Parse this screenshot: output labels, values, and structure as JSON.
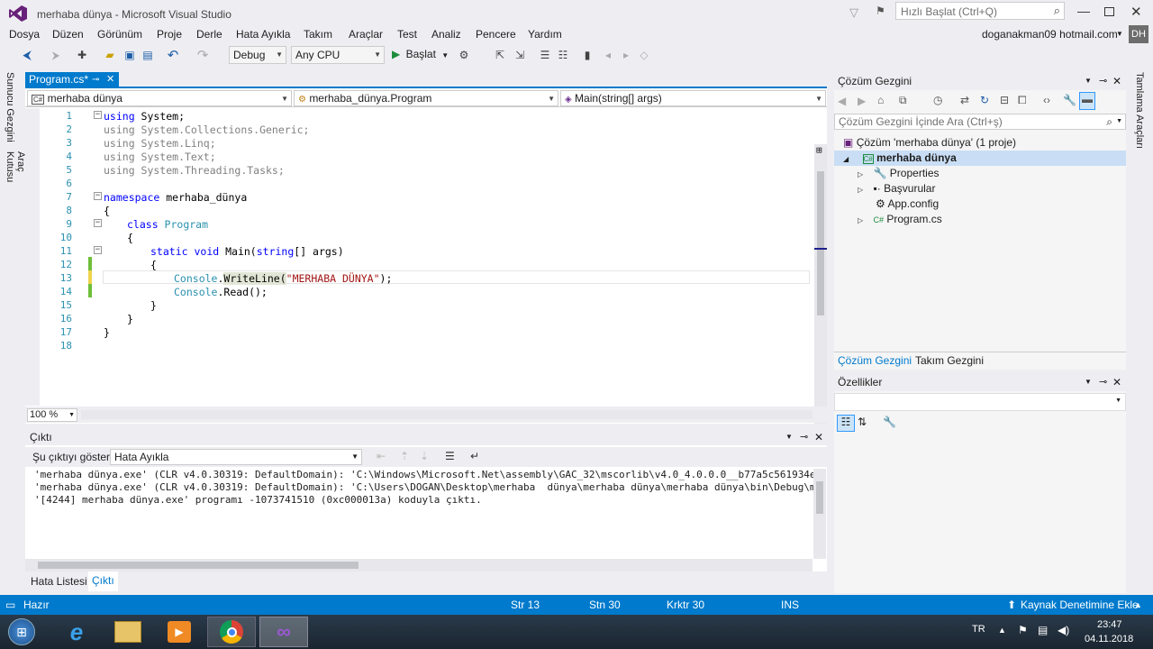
{
  "window": {
    "title": "merhaba dünya - Microsoft Visual Studio",
    "quick_launch_placeholder": "Hızlı Başlat (Ctrl+Q)",
    "user": "doganakman09 hotmail.com",
    "user_initials": "DH"
  },
  "menu": [
    "Dosya",
    "Düzen",
    "Görünüm",
    "Proje",
    "Derle",
    "Hata Ayıkla",
    "Takım",
    "Araçlar",
    "Test",
    "Analiz",
    "Pencere",
    "Yardım"
  ],
  "toolbar": {
    "config": "Debug",
    "platform": "Any CPU",
    "start_label": "Başlat"
  },
  "left_strip": [
    "Sunucu Gezgini",
    "Araç Kutusu"
  ],
  "right_strip": "Tamlama Araçları",
  "editor": {
    "tab_label": "Program.cs*",
    "nav_project": "merhaba dünya",
    "nav_class": "merhaba_dünya.Program",
    "nav_member": "Main(string[] args)",
    "zoom": "100 %",
    "line_numbers": [
      "1",
      "2",
      "3",
      "4",
      "5",
      "6",
      "7",
      "8",
      "9",
      "10",
      "11",
      "12",
      "13",
      "14",
      "15",
      "16",
      "17",
      "18"
    ],
    "lines": {
      "l1_kw": "using",
      "l1_rest": " System;",
      "l2": "using System.Collections.Generic;",
      "l3": "using System.Linq;",
      "l4": "using System.Text;",
      "l5": "using System.Threading.Tasks;",
      "l7_kw": "namespace",
      "l7_rest": " merhaba_dünya",
      "l8": "{",
      "l9_kw": "class",
      "l9_name": " Program",
      "l10": "{",
      "l11_kw1": "static",
      "l11_kw2": " void",
      "l11_rest": " Main(",
      "l11_kw3": "string",
      "l11_rest2": "[] args)",
      "l12": "{",
      "l13_cls": "Console",
      "l13_dot": ".",
      "l13_m": "WriteLine",
      "l13_p": "(",
      "l13_str": "\"MERHABA DÜNYA\"",
      "l13_end": ");",
      "l14_cls": "Console",
      "l14_rest": ".Read();",
      "l15": "}",
      "l16": "}",
      "l17": "}"
    }
  },
  "output": {
    "title": "Çıktı",
    "show_label": "Şu çıktıyı göster:",
    "source": "Hata Ayıkla",
    "lines": [
      "'merhaba dünya.exe' (CLR v4.0.30319: DefaultDomain): 'C:\\Windows\\Microsoft.Net\\assembly\\GAC_32\\mscorlib\\v4.0_4.0.0.0__b77a5c561934e",
      "'merhaba dünya.exe' (CLR v4.0.30319: DefaultDomain): 'C:\\Users\\DOGAN\\Desktop\\merhaba  dünya\\merhaba dünya\\merhaba dünya\\bin\\Debug\\m",
      "'[4244] merhaba dünya.exe' programı -1073741510 (0xc000013a) koduyla çıktı."
    ],
    "tabs": [
      "Hata Listesi",
      "Çıktı"
    ]
  },
  "solution": {
    "title": "Çözüm Gezgini",
    "search_placeholder": "Çözüm Gezgini İçinde Ara (Ctrl+ş)",
    "items": [
      "Çözüm 'merhaba dünya' (1 proje)",
      "merhaba dünya",
      "Properties",
      "Başvurular",
      "App.config",
      "Program.cs"
    ],
    "tabs": [
      "Çözüm Gezgini",
      "Takım Gezgini"
    ]
  },
  "properties": {
    "title": "Özellikler"
  },
  "status": {
    "ready": "Hazır",
    "line": "Str 13",
    "col": "Stn 30",
    "char": "Krktr 30",
    "mode": "INS",
    "source_control": "Kaynak Denetimine Ekle"
  },
  "taskbar": {
    "lang": "TR",
    "time": "23:47",
    "date": "04.11.2018"
  },
  "colors": {
    "accent": "#007acc",
    "vs_purple": "#68217a",
    "keyword": "#0000ff",
    "type": "#2b91af",
    "string": "#a31515"
  }
}
